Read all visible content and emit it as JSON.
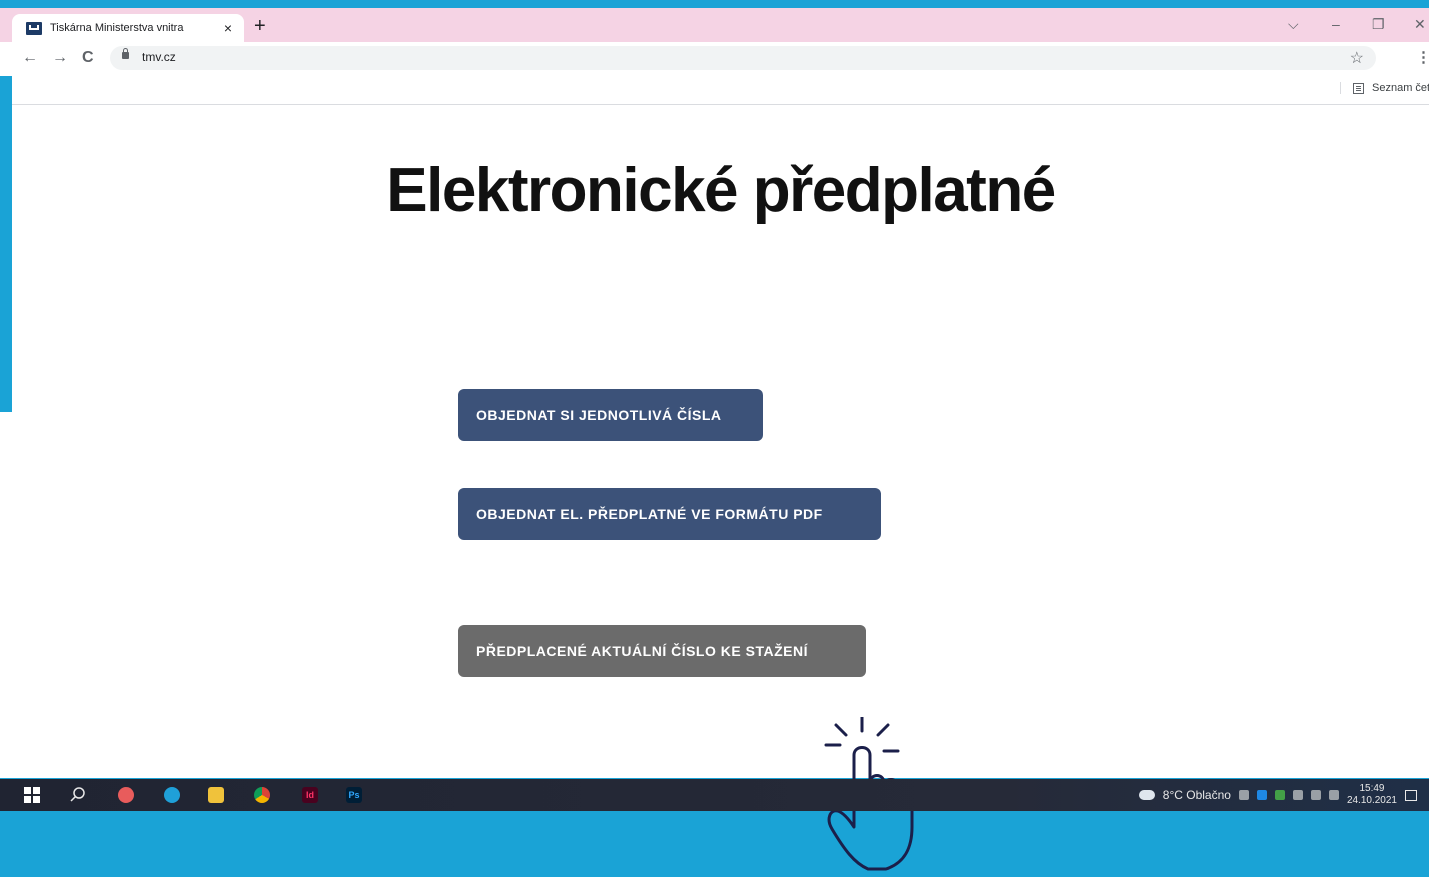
{
  "browser": {
    "tab": {
      "title": "Tiskárna Ministerstva vnitra",
      "close": "×"
    },
    "new_tab": "+",
    "window_controls": {
      "dropdown": "⌵",
      "minimize": "–",
      "maximize": "❐",
      "close": "✕"
    },
    "nav": {
      "back": "←",
      "forward": "→",
      "reload": "C"
    },
    "url": "tmv.cz",
    "star": "☆",
    "menu": "⋮",
    "reading_list": "Seznam četby"
  },
  "page": {
    "heading": "Elektronické předplatné",
    "buttons": [
      "OBJEDNAT SI JEDNOTLIVÁ ČÍSLA",
      "OBJEDNAT EL. PŘEDPLATNÉ VE FORMÁTU PDF",
      "PŘEDPLACENÉ AKTUÁLNÍ ČÍSLO KE STAŽENÍ"
    ]
  },
  "taskbar": {
    "apps": [
      {
        "name": "paint-icon",
        "color": "#e85c5c"
      },
      {
        "name": "edge-icon",
        "color": "#1fa0d8"
      },
      {
        "name": "file-explorer-icon",
        "color": "#f0c23b"
      },
      {
        "name": "chrome-icon",
        "color": "#4caf50"
      },
      {
        "name": "indesign-icon",
        "label": "Id",
        "color": "#49021f"
      },
      {
        "name": "photoshop-icon",
        "label": "Ps",
        "color": "#001e36"
      }
    ],
    "weather": "8°C Oblačno",
    "time": "15:49",
    "date": "24.10.2021"
  },
  "colors": {
    "frame": "#1aa3d6",
    "tabbar": "#f5d3e4",
    "button_primary": "#3c5279",
    "button_secondary": "#6b6b6b"
  }
}
